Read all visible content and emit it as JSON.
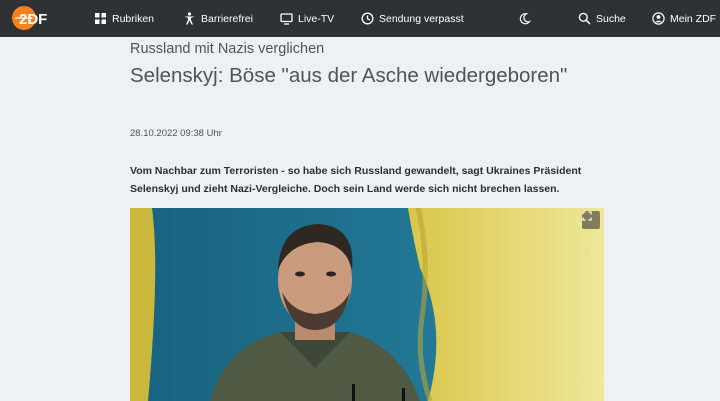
{
  "nav": {
    "logo_text": "ZDF",
    "items": [
      {
        "label": "Rubriken",
        "icon": "grid-icon"
      },
      {
        "label": "Barrierefrei",
        "icon": "accessibility-icon"
      },
      {
        "label": "Live-TV",
        "icon": "tv-icon"
      },
      {
        "label": "Sendung verpasst",
        "icon": "clock-icon"
      }
    ],
    "theme_icon": "moon-icon",
    "search_label": "Suche",
    "account_label": "Mein ZDF"
  },
  "article": {
    "kicker": "Russland mit Nazis verglichen",
    "headline": "Selenskyj: Böse \"aus der Asche wiedergeboren\"",
    "date": "28.10.2022 09:38 Uhr",
    "lead": "Vom Nachbar zum Terroristen - so habe sich Russland gewandelt, sagt Ukraines Präsident Selenskyj und zieht Nazi-Vergleiche. Doch sein Land werde sich nicht brechen lassen."
  },
  "colors": {
    "nav_bg": "#2f3135",
    "page_bg": "#eef0f2",
    "logo_orange": "#f5821f",
    "text": "#2b2f33"
  }
}
